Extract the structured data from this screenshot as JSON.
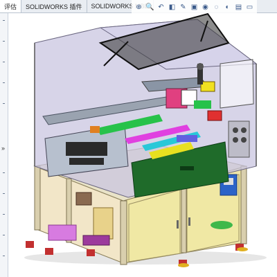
{
  "tabs": [
    {
      "label": "评估",
      "active": true
    },
    {
      "label": "SOLIDWORKS 插件",
      "active": false
    },
    {
      "label": "SOLIDWORKS MBD",
      "active": false
    }
  ],
  "toolbar_icons": [
    "zoom-to-fit-icon",
    "zoom-area-icon",
    "previous-view-icon",
    "section-view-icon",
    "dynamic-annotation-icon",
    "view-orientation-icon",
    "display-style-icon",
    "hide-show-icon",
    "edit-appearance-icon",
    "apply-scene-icon",
    "view-settings-icon"
  ],
  "side_panel": {
    "collapse_glyph": "»"
  },
  "colors": {
    "frame": "#e8e2c8",
    "frame_edge": "#b7ad82",
    "panel_yellow": "#f0e9b3",
    "enclosure": "#c9c6df",
    "dark_green": "#1f6b2a",
    "control_blue": "#2b63c8",
    "hood_black": "#2a2a2a"
  }
}
